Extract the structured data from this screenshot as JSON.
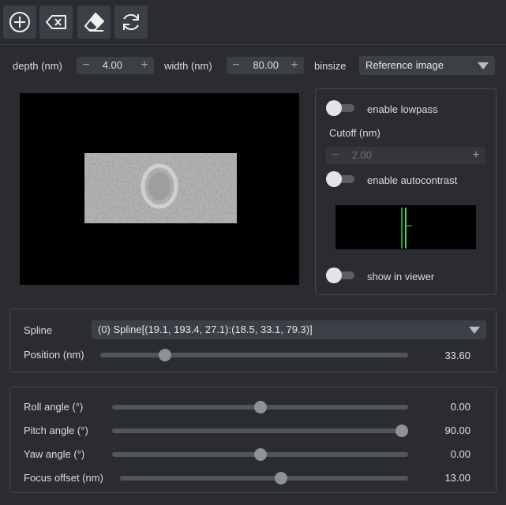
{
  "toolbar": {
    "buttons": [
      {
        "icon": "add-circle-icon"
      },
      {
        "icon": "backspace-icon"
      },
      {
        "icon": "eraser-icon"
      },
      {
        "icon": "refresh-icon"
      }
    ]
  },
  "params": {
    "depth_label": "depth (nm)",
    "depth_value": "4.00",
    "width_label": "width (nm)",
    "width_value": "80.00",
    "binsize_label": "binsize",
    "binsize_value": "Reference image"
  },
  "filters": {
    "lowpass_label": "enable lowpass",
    "lowpass_enabled": false,
    "cutoff_label": "Cutoff (nm)",
    "cutoff_value": "2.00",
    "autocontrast_label": "enable autocontrast",
    "autocontrast_enabled": false,
    "show_in_viewer_label": "show in viewer",
    "show_in_viewer_enabled": false
  },
  "spline": {
    "label": "Spline",
    "selected": "(0) Spline[(19.1, 193.4, 27.1):(18.5, 33.1, 79.3)]",
    "position_label": "Position (nm)",
    "position_value": "33.60",
    "position_fraction": 0.21
  },
  "angles": {
    "roll_label": "Roll angle (°)",
    "roll_value": "0.00",
    "roll_fraction": 0.5,
    "pitch_label": "Pitch angle (°)",
    "pitch_value": "90.00",
    "pitch_fraction": 1.0,
    "yaw_label": "Yaw angle (°)",
    "yaw_value": "0.00",
    "yaw_fraction": 0.5,
    "focus_label": "Focus offset (nm)",
    "focus_value": "13.00",
    "focus_fraction": 0.56
  },
  "colors": {
    "accent_green": "#39d353",
    "background": "#2a2c32"
  }
}
